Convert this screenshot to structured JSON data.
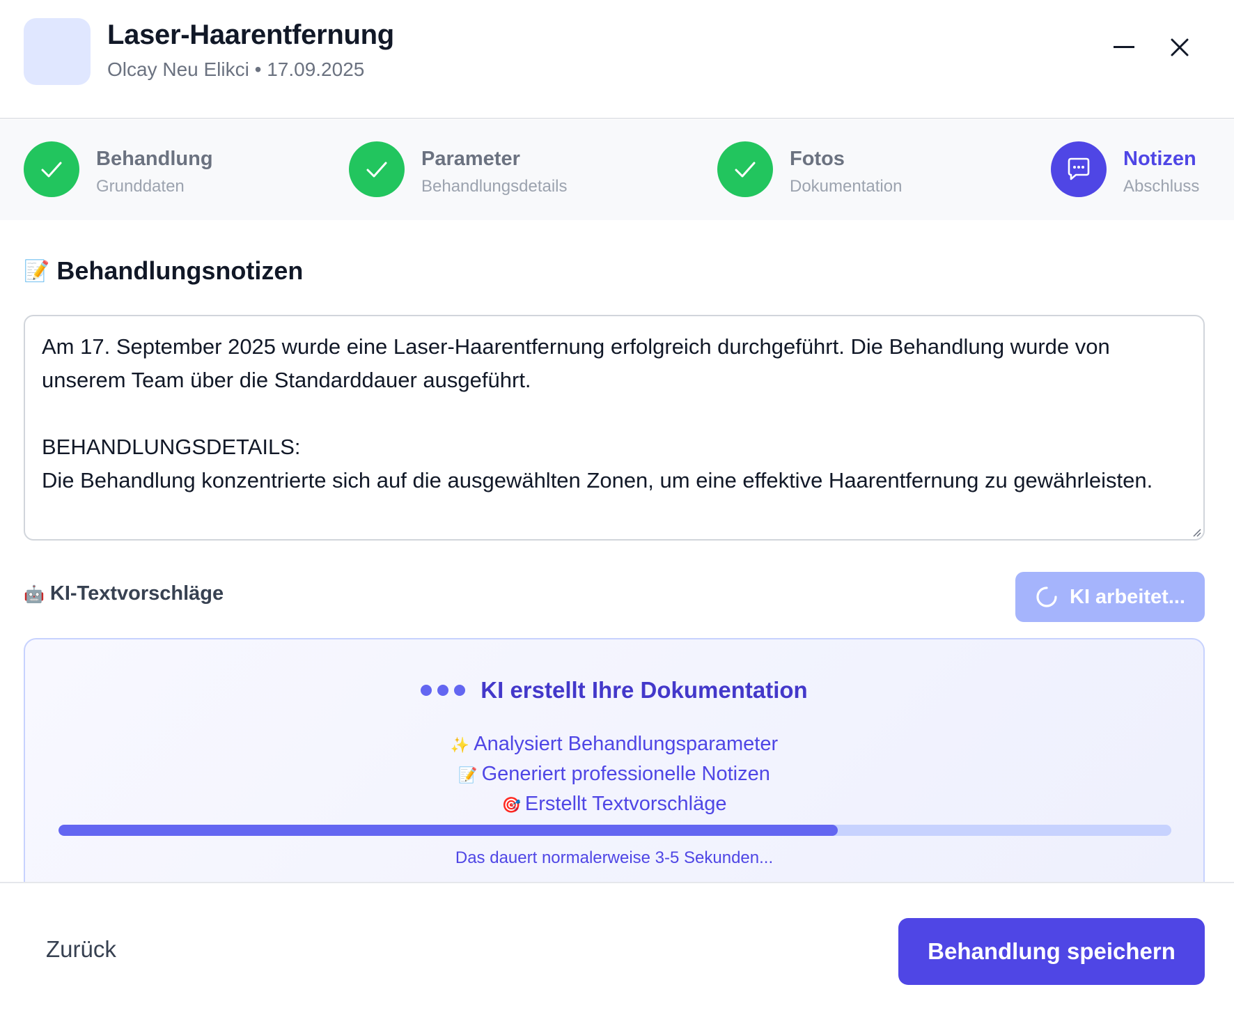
{
  "header": {
    "title": "Laser-Haarentfernung",
    "subtitle": "Olcay Neu Elikci • 17.09.2025",
    "minimize_icon": "minus-icon",
    "close_icon": "close-icon"
  },
  "steps": [
    {
      "label": "Behandlung",
      "sub": "Grunddaten",
      "status": "done",
      "icon": "check-icon"
    },
    {
      "label": "Parameter",
      "sub": "Behandlungsdetails",
      "status": "done",
      "icon": "check-icon"
    },
    {
      "label": "Fotos",
      "sub": "Dokumentation",
      "status": "done",
      "icon": "check-icon"
    },
    {
      "label": "Notizen",
      "sub": "Abschluss",
      "status": "active",
      "icon": "chat-bubble-icon"
    }
  ],
  "notes": {
    "section_emoji": "📝",
    "section_title": "Behandlungsnotizen",
    "text": "Am 17. September 2025 wurde eine Laser-Haarentfernung erfolgreich durchgeführt. Die Behandlung wurde von unserem Team über die Standarddauer ausgeführt.\n\nBEHANDLUNGSDETAILS:\nDie Behandlung konzentrierte sich auf die ausgewählten Zonen, um eine effektive Haarentfernung zu gewährleisten."
  },
  "ai": {
    "label_emoji": "🤖",
    "label": "KI-Textvorschläge",
    "button_label": "KI arbeitet...",
    "panel_title": "KI erstellt Ihre Dokumentation",
    "items": [
      {
        "emoji": "✨",
        "text": "Analysiert Behandlungsparameter"
      },
      {
        "emoji": "📝",
        "text": "Generiert professionelle Notizen"
      },
      {
        "emoji": "🎯",
        "text": "Erstellt Textvorschläge"
      }
    ],
    "progress": 0.7,
    "note": "Das dauert normalerweise 3-5 Sekunden..."
  },
  "footer": {
    "back_label": "Zurück",
    "save_label": "Behandlung speichern"
  },
  "colors": {
    "accent": "#4f46e5",
    "success": "#22c55e",
    "ai_button": "#a5b4fc",
    "progress_track": "#c7d2fe"
  }
}
